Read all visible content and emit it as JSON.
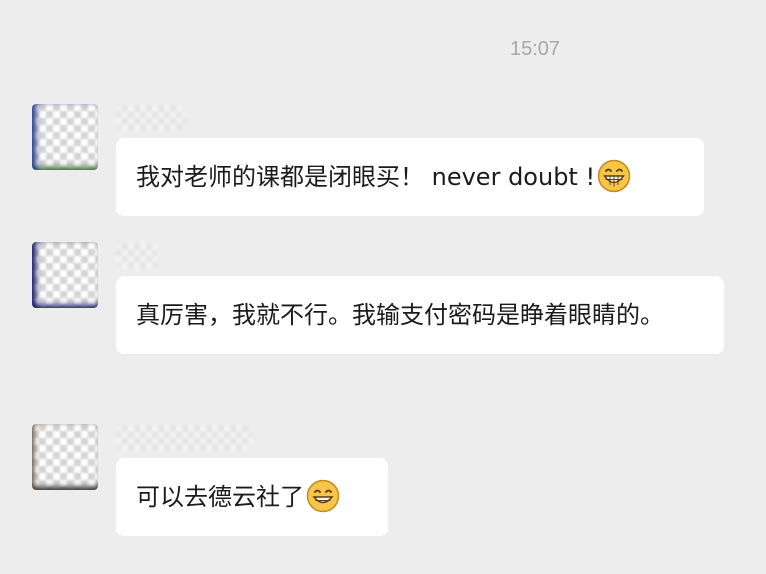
{
  "chat": {
    "timestamp": "15:07",
    "messages": [
      {
        "text": "我对老师的课都是闭眼买！ never doubt !",
        "emoji": "grinning-face-emoji",
        "avatar_edge_color": "#2b3f8f"
      },
      {
        "text": "真厉害，我就不行。我输支付密码是睁着眼睛的。",
        "emoji": "",
        "avatar_edge_color": "#1d1f6b"
      },
      {
        "text": "可以去德云社了",
        "emoji": "grinning-squinting-face-emoji",
        "avatar_edge_color": "#6a5640"
      }
    ]
  }
}
